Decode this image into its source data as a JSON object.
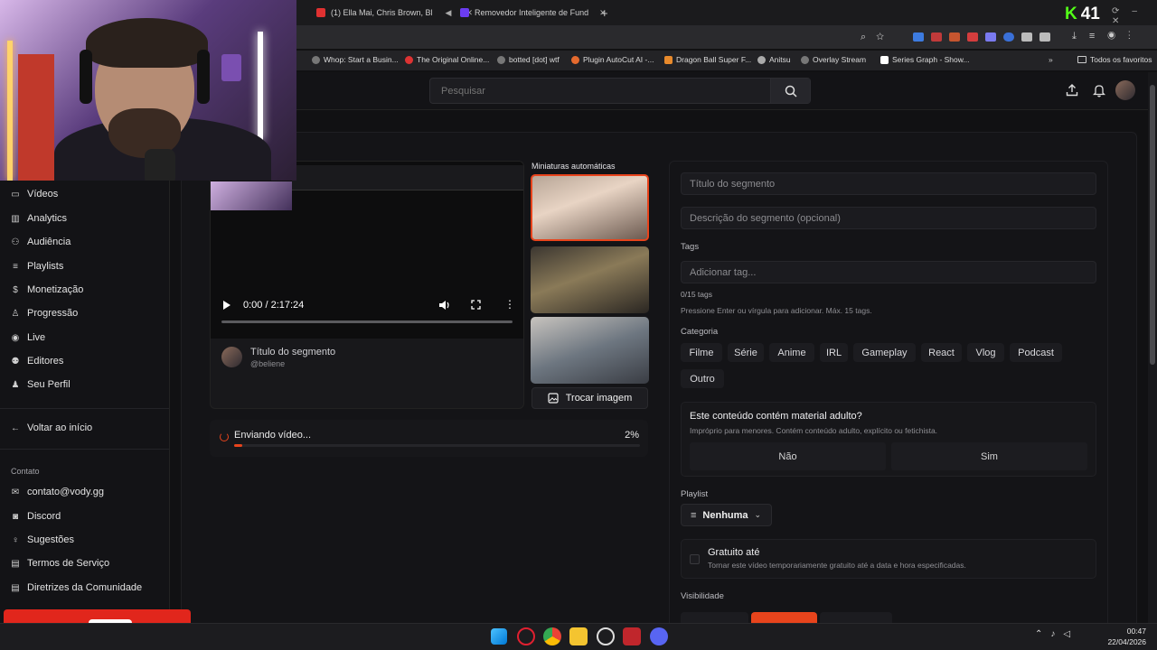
{
  "browser": {
    "tabs": [
      {
        "title": "(1) Ella Mai, Chris Brown, Bl",
        "color": "#e03131"
      },
      {
        "title": "Removedor Inteligente de Fund",
        "color": "#6b3cf0"
      }
    ],
    "bookmarks": [
      "Whop: Start a Busin...",
      "The Original Online...",
      "botted [dot] wtf",
      "Plugin AutoCut AI -...",
      "Dragon Ball Super F...",
      "Anitsu",
      "Overlay Stream",
      "Series Graph - Show..."
    ],
    "bookmarks_folder": "Todos os favoritos",
    "counter_letter": "K",
    "counter_value": "41"
  },
  "header": {
    "search_placeholder": "Pesquisar"
  },
  "sidebar": {
    "items": [
      {
        "label": "Vídeos",
        "icon": "video-icon"
      },
      {
        "label": "Analytics",
        "icon": "chart-icon"
      },
      {
        "label": "Audiência",
        "icon": "users-icon"
      },
      {
        "label": "Playlists",
        "icon": "playlist-icon"
      },
      {
        "label": "Monetização",
        "icon": "dollar-icon"
      },
      {
        "label": "Progressão",
        "icon": "trophy-icon"
      },
      {
        "label": "Live",
        "icon": "broadcast-icon"
      },
      {
        "label": "Editores",
        "icon": "editors-icon"
      },
      {
        "label": "Seu Perfil",
        "icon": "user-icon"
      }
    ],
    "back_label": "Voltar ao início",
    "contact_heading": "Contato",
    "contact_items": [
      {
        "label": "contato@vody.gg",
        "icon": "mail-icon"
      },
      {
        "label": "Discord",
        "icon": "discord-icon"
      },
      {
        "label": "Sugestões",
        "icon": "lightbulb-icon"
      },
      {
        "label": "Termos de Serviço",
        "icon": "document-icon"
      },
      {
        "label": "Diretrizes da Comunidade",
        "icon": "document-icon"
      }
    ]
  },
  "video": {
    "time": "0:00 / 2:17:24",
    "progress": 0,
    "title": "Título do segmento",
    "channel": "@beliene"
  },
  "thumbnails": {
    "heading": "Miniaturas automáticas",
    "change_button": "Trocar imagem",
    "selected_index": 0
  },
  "upload": {
    "status": "Enviando vídeo...",
    "percent": "2%",
    "progress": 0.02
  },
  "form": {
    "title_placeholder": "Título do segmento",
    "description_placeholder": "Descrição do segmento (opcional)",
    "tags_label": "Tags",
    "tags_placeholder": "Adicionar tag...",
    "tags_count": "0/15 tags",
    "tags_hint": "Pressione Enter ou vírgula para adicionar. Máx. 15 tags.",
    "category_label": "Categoria",
    "categories": [
      "Filme",
      "Série",
      "Anime",
      "IRL",
      "Gameplay",
      "React",
      "Vlog",
      "Podcast",
      "Outro"
    ],
    "adult_question": "Este conteúdo contém material adulto?",
    "adult_hint": "Impróprio para menores. Contém conteúdo adulto, explícito ou fetichista.",
    "adult_no": "Não",
    "adult_yes": "Sim",
    "playlist_label": "Playlist",
    "playlist_value": "Nenhuma",
    "free_until_label": "Gratuito até",
    "free_until_hint": "Tornar este vídeo temporariamente gratuito até a data e hora especificadas.",
    "visibility_label": "Visibilidade"
  },
  "taskbar": {
    "time": "00:47",
    "date": "22/04/2026"
  },
  "colors": {
    "accent": "#e8441c",
    "thumb_selected": "#e8441c"
  }
}
